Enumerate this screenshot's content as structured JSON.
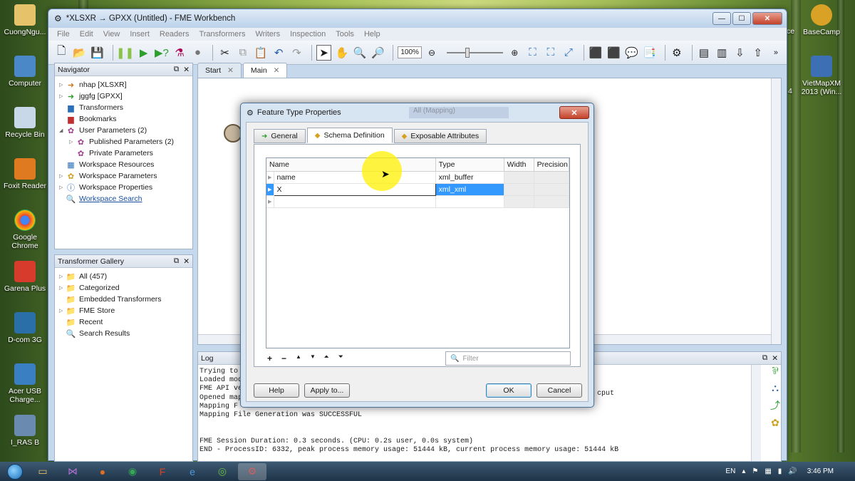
{
  "window": {
    "title": "*XLSXR → GPXX (Untitled) - FME Workbench",
    "menu": [
      "File",
      "Edit",
      "View",
      "Insert",
      "Readers",
      "Transformers",
      "Writers",
      "Inspection",
      "Tools",
      "Help"
    ],
    "zoom": "100%"
  },
  "desktop": {
    "left_icons": [
      "CuongNgu...",
      "Computer",
      "Recycle Bin",
      "Foxit Reader",
      "Google Chrome",
      "Garena Plus",
      "D-com 3G",
      "Acer USB Charge...",
      "I_RAS B"
    ],
    "right_icons": [
      "BaseCamp",
      "VietMapXM 2013 (Win..."
    ],
    "partial_labels": [
      "ce",
      "4"
    ]
  },
  "navigator": {
    "title": "Navigator",
    "items": [
      {
        "label": "nhap [XLSXR]",
        "icon": "reader-arrow-icon"
      },
      {
        "label": "jggfg [GPXX]",
        "icon": "writer-arrow-icon"
      },
      {
        "label": "Transformers",
        "icon": "transformer-icon"
      },
      {
        "label": "Bookmarks",
        "icon": "bookmark-icon"
      },
      {
        "label": "User Parameters (2)",
        "icon": "gear-icon"
      },
      {
        "label": "Published Parameters (2)",
        "icon": "gear-icon"
      },
      {
        "label": "Private Parameters",
        "icon": "gear-icon"
      },
      {
        "label": "Workspace Resources",
        "icon": "resource-icon"
      },
      {
        "label": "Workspace Parameters",
        "icon": "gear-icon"
      },
      {
        "label": "Workspace Properties",
        "icon": "info-icon"
      },
      {
        "label": "Workspace Search",
        "icon": "search-icon"
      }
    ]
  },
  "gallery": {
    "title": "Transformer Gallery",
    "items": [
      "All (457)",
      "Categorized",
      "Embedded Transformers",
      "FME Store",
      "Recent",
      "Search Results"
    ]
  },
  "tabs": [
    "Start",
    "Main"
  ],
  "log": {
    "title": "Log",
    "lines": [
      "Trying to",
      "Loaded mod",
      "FME API ve",
      "Opened map",
      "Mapping F",
      "Mapping File Generation was SUCCESSFUL",
      "",
      "",
      "FME Session Duration: 0.3 seconds. (CPU: 0.2s user, 0.0s system)",
      "END - ProcessID: 6332, peak process memory usage: 51444 kB, current process memory usage: 51444 kB"
    ],
    "partial_right": "cput"
  },
  "dialog": {
    "title": "Feature Type Properties",
    "tabs": [
      "General",
      "Schema Definition",
      "Exposable Attributes"
    ],
    "columns": [
      "Name",
      "Type",
      "Width",
      "Precision"
    ],
    "rows": [
      {
        "name": "name",
        "type": "xml_buffer"
      },
      {
        "name": "X",
        "type": "xml_xml"
      }
    ],
    "filter_placeholder": "Filter",
    "buttons": {
      "help": "Help",
      "apply": "Apply to...",
      "ok": "OK",
      "cancel": "Cancel"
    },
    "ghost_text": "All (Mapping)"
  },
  "taskbar": {
    "lang": "EN",
    "time": "3:46 PM"
  }
}
